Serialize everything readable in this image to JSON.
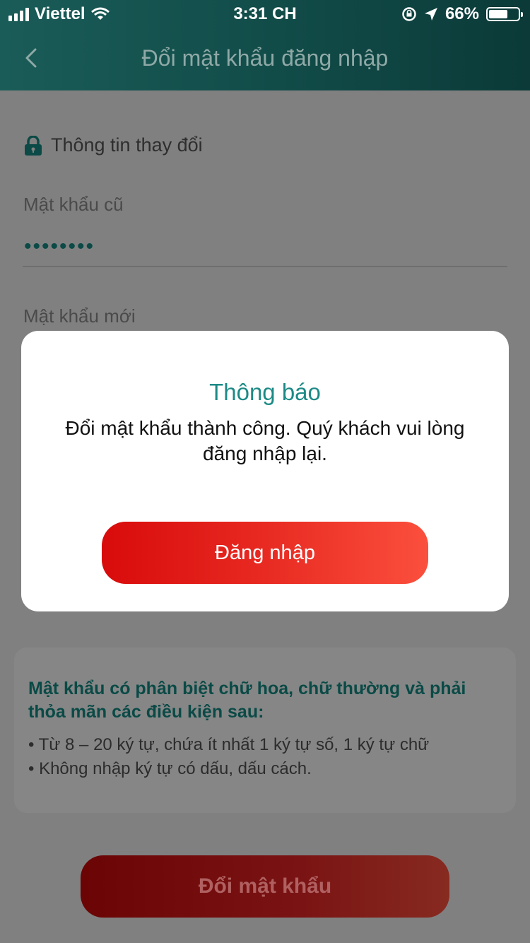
{
  "status_bar": {
    "carrier": "Viettel",
    "time": "3:31 CH",
    "battery": "66%",
    "battery_level": 0.66
  },
  "header": {
    "title": "Đổi mật khẩu đăng nhập",
    "back_icon": "chevron-left-icon"
  },
  "form": {
    "section_title": "Thông tin thay đổi",
    "section_icon": "lock-icon",
    "old_password_label": "Mật khẩu cũ",
    "old_password_value": "••••••••",
    "new_password_label": "Mật khẩu mới"
  },
  "requirements": {
    "heading": "Mật khẩu có phân biệt chữ hoa, chữ thường và phải thỏa mãn các điều kiện sau:",
    "items": [
      "• Từ 8 – 20 ký tự, chứa ít nhất 1 ký tự số, 1 ký tự chữ",
      "• Không nhập ký tự có dấu, dấu cách."
    ]
  },
  "submit_button": "Đổi mật khẩu",
  "modal": {
    "title": "Thông báo",
    "message": "Đổi mật khẩu thành công. Quý khách vui lòng đăng nhập lại.",
    "button": "Đăng nhập"
  },
  "colors": {
    "header": "#114b48",
    "accent_teal": "#1c8a86",
    "button_red": "#e82a22",
    "overlay": "#808080"
  }
}
